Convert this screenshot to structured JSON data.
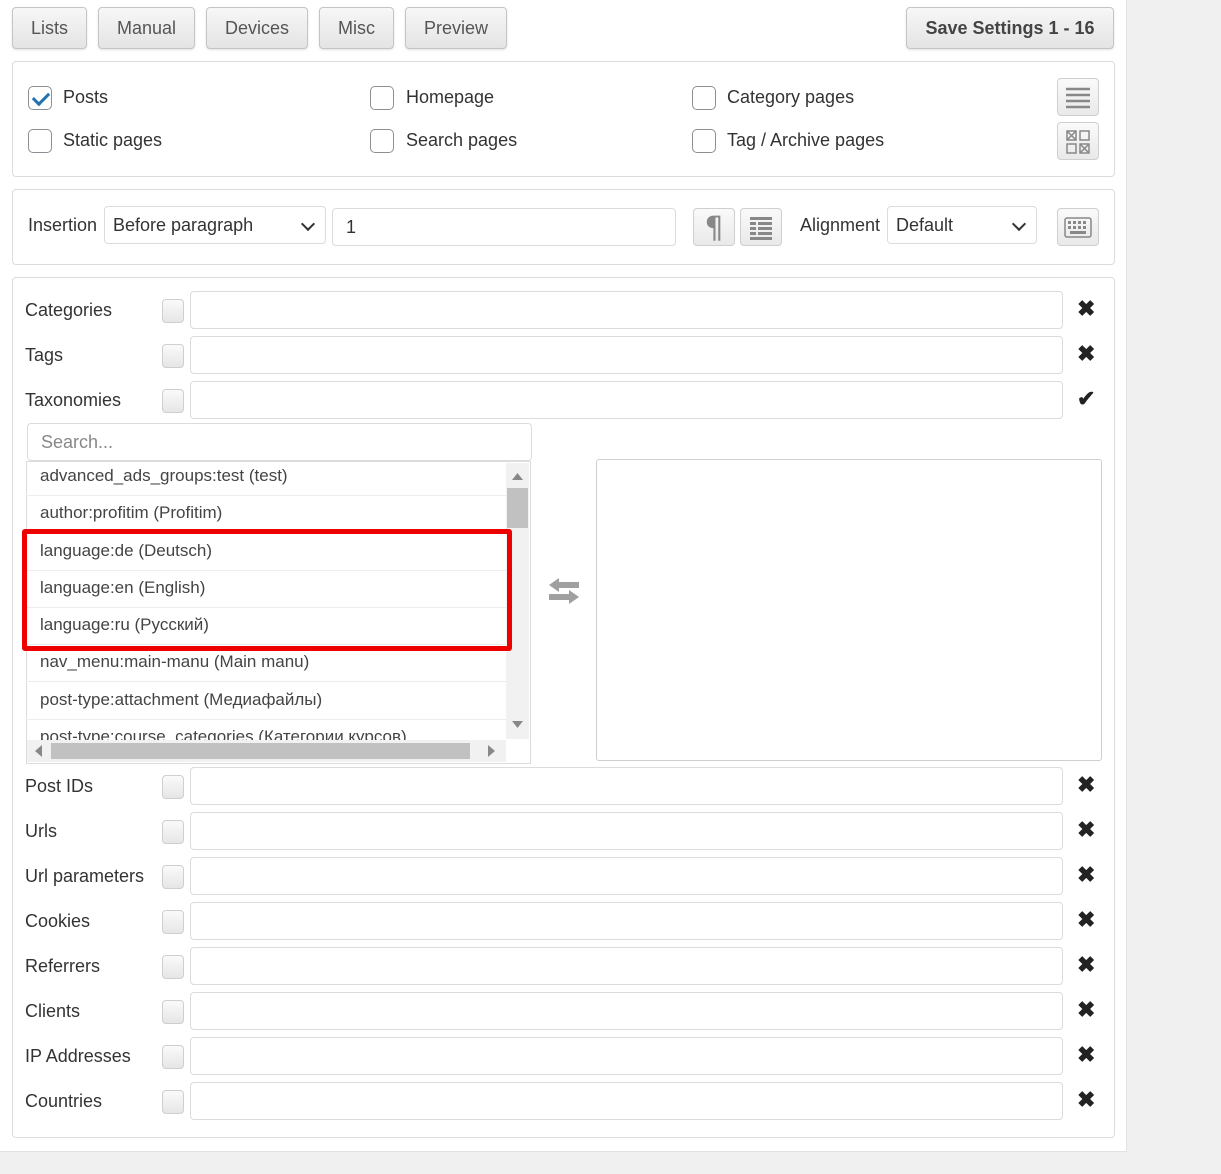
{
  "tabs": [
    "Lists",
    "Manual",
    "Devices",
    "Misc",
    "Preview"
  ],
  "save_button": "Save Settings 1 - 16",
  "page_types": [
    {
      "label": "Posts",
      "checked": true
    },
    {
      "label": "Homepage",
      "checked": false
    },
    {
      "label": "Category pages",
      "checked": false
    },
    {
      "label": "Static pages",
      "checked": false
    },
    {
      "label": "Search pages",
      "checked": false
    },
    {
      "label": "Tag / Archive pages",
      "checked": false
    }
  ],
  "insertion": {
    "label": "Insertion",
    "selected": "Before paragraph",
    "number": "1",
    "alignment_label": "Alignment",
    "alignment_selected": "Default"
  },
  "filters_top": [
    {
      "label": "Categories",
      "status": "x-icon"
    },
    {
      "label": "Tags",
      "status": "x-icon"
    },
    {
      "label": "Taxonomies",
      "status": "check-icon"
    }
  ],
  "taxonomy_list": {
    "search_placeholder": "Search...",
    "items": [
      "advanced_ads_groups:test (test)",
      "author:profitim (Profitim)",
      "language:de (Deutsch)",
      "language:en (English)",
      "language:ru (Русский)",
      "nav_menu:main-manu (Main manu)",
      "post-type:attachment (Медиафайлы)",
      "post-type:course_categories (Категории курсов)"
    ]
  },
  "filters_bottom": [
    {
      "label": "Post IDs"
    },
    {
      "label": "Urls"
    },
    {
      "label": "Url parameters"
    },
    {
      "label": "Cookies"
    },
    {
      "label": "Referrers"
    },
    {
      "label": "Clients"
    },
    {
      "label": "IP Addresses"
    },
    {
      "label": "Countries"
    }
  ],
  "colors": {
    "highlight_border": "#ee0000",
    "accent": "#2271b1"
  }
}
